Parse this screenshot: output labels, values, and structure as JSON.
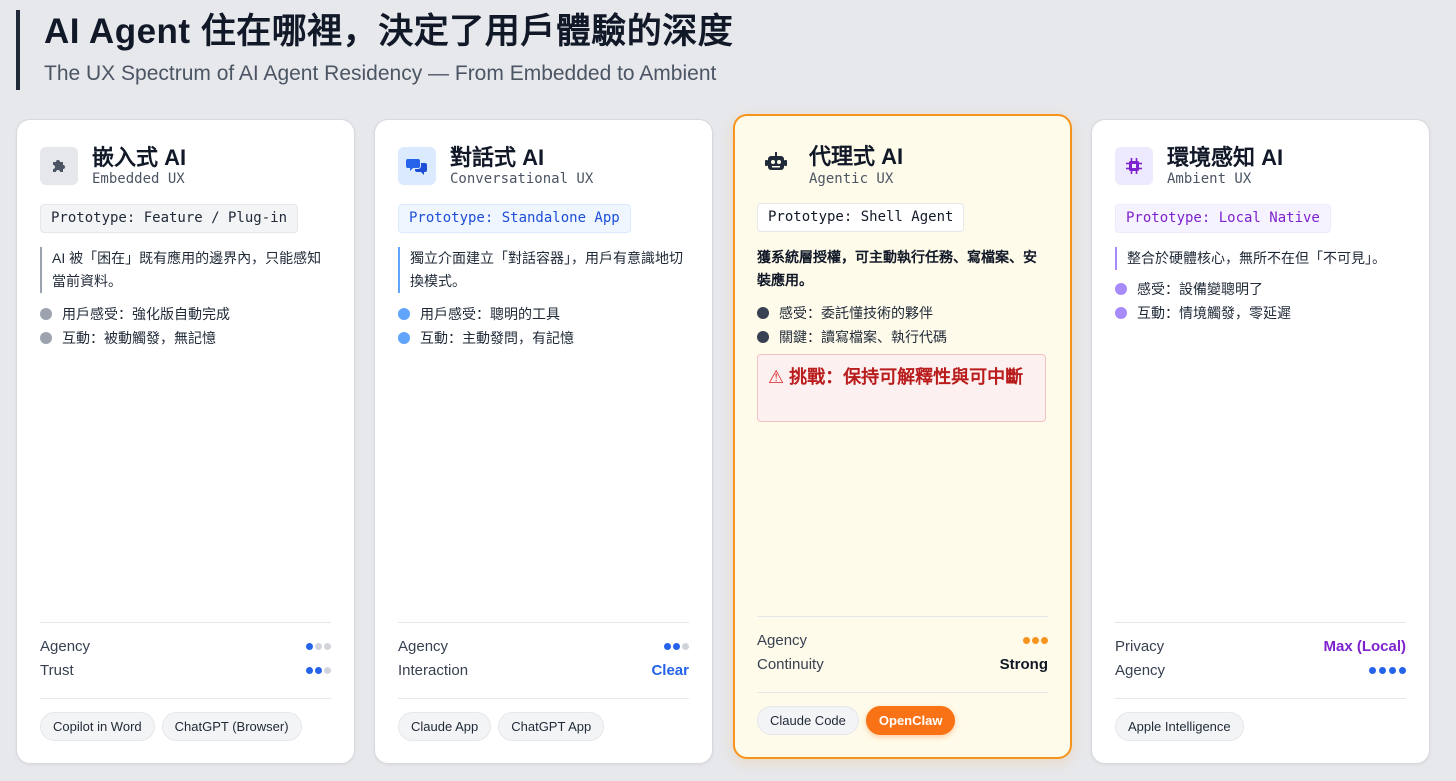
{
  "header": {
    "title": "AI Agent 住在哪裡，決定了用戶體驗的深度",
    "subtitle": "The UX Spectrum of AI Agent Residency — From Embedded to Ambient"
  },
  "cards": [
    {
      "title": "嵌入式 AI",
      "subtitle": "Embedded UX",
      "icon": "puzzle-icon",
      "prototype": "Prototype: Feature / Plug-in",
      "description": "AI 被「困在」既有應用的邊界內，只能感知當前資料。",
      "bullets": [
        "用戶感受：強化版自動完成",
        "互動：被動觸發，無記憶"
      ],
      "metrics": [
        {
          "label": "Agency",
          "dots": 1,
          "total": 3
        },
        {
          "label": "Trust",
          "dots": 2,
          "total": 3
        }
      ],
      "tags": [
        "Copilot in Word",
        "ChatGPT (Browser)"
      ],
      "accent": "#9ca3af"
    },
    {
      "title": "對話式 AI",
      "subtitle": "Conversational UX",
      "icon": "chat-bubbles-icon",
      "prototype": "Prototype: Standalone App",
      "description": "獨立介面建立「對話容器」，用戶有意識地切換模式。",
      "bullets": [
        "用戶感受：聰明的工具",
        "互動：主動發問，有記憶"
      ],
      "metrics": [
        {
          "label": "Agency",
          "dots": 2,
          "total": 3
        },
        {
          "label": "Interaction",
          "value": "Clear"
        }
      ],
      "tags": [
        "Claude App",
        "ChatGPT App"
      ],
      "accent": "#60a5fa"
    },
    {
      "title": "代理式 AI",
      "subtitle": "Agentic UX",
      "icon": "robot-icon",
      "prototype": "Prototype: Shell Agent",
      "description": "獲系統層授權，可主動執行任務、寫檔案、安裝應用。",
      "bullets": [
        "感受：委託懂技術的夥伴",
        "關鍵：讀寫檔案、執行代碼"
      ],
      "challenge": "挑戰：保持可解釋性與可中斷",
      "metrics": [
        {
          "label": "Agency",
          "dots": 3,
          "total": 3
        },
        {
          "label": "Continuity",
          "value": "Strong"
        }
      ],
      "tags": [
        "Claude Code",
        "OpenClaw"
      ],
      "accent": "#374151"
    },
    {
      "title": "環境感知 AI",
      "subtitle": "Ambient UX",
      "icon": "chip-icon",
      "prototype": "Prototype: Local Native",
      "description": "整合於硬體核心，無所不在但「不可見」。",
      "bullets": [
        "感受：設備變聰明了",
        "互動：情境觸發，零延遲"
      ],
      "metrics": [
        {
          "label": "Privacy",
          "value": "Max (Local)"
        },
        {
          "label": "Agency",
          "dots": 4,
          "total": 4
        }
      ],
      "tags": [
        "Apple Intelligence"
      ],
      "accent": "#a78bfa"
    }
  ],
  "colors": {
    "blue": "#2563eb",
    "orange": "#f7941d",
    "purple": "#7e22ce",
    "red": "#dc2626"
  }
}
